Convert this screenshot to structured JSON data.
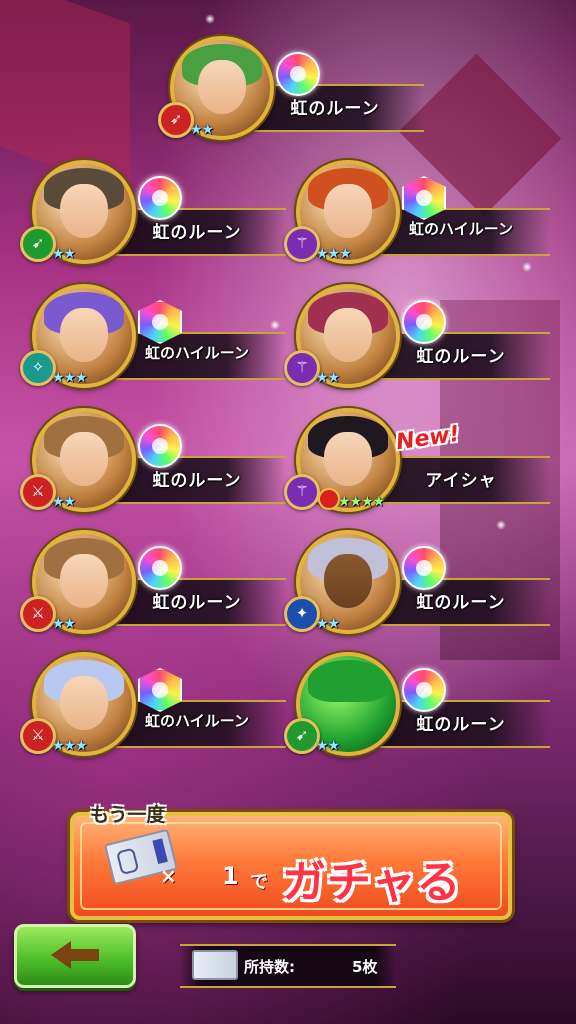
{
  "results": [
    {
      "name": "虹のルーン",
      "rune": "rune-icon",
      "weapon": "bow-icon",
      "weapon_color": "#c22",
      "stars": "★★",
      "star_color": "#8fe6ff",
      "hair": "#4aa040",
      "new": false
    },
    {
      "name": "虹のルーン",
      "rune": "rune-icon",
      "weapon": "spear-icon",
      "weapon_color": "#1f9a2e",
      "stars": "★★",
      "star_color": "#8fe6ff",
      "hair": "#5a4a3a",
      "new": false
    },
    {
      "name": "虹のハイルーン",
      "rune": "high-rune-icon",
      "weapon": "staff-icon",
      "weapon_color": "#7a2db0",
      "stars": "★★★",
      "star_color": "#8fe6ff",
      "hair": "#d05020",
      "new": false
    },
    {
      "name": "虹のハイルーン",
      "rune": "high-rune-icon",
      "weapon": "wing-icon",
      "weapon_color": "#1a9a8c",
      "stars": "★★★",
      "star_color": "#8fe6ff",
      "hair": "#7a5ad0",
      "new": false
    },
    {
      "name": "虹のルーン",
      "rune": "rune-icon",
      "weapon": "staff-icon",
      "weapon_color": "#7a2db0",
      "stars": "★★",
      "star_color": "#8fe6ff",
      "hair": "#a03050",
      "new": false
    },
    {
      "name": "虹のルーン",
      "rune": "rune-icon",
      "weapon": "sword-icon",
      "weapon_color": "#c22",
      "stars": "★★",
      "star_color": "#8fe6ff",
      "hair": "#a07040",
      "new": false
    },
    {
      "name": "アイシャ",
      "rune": "",
      "weapon": "staff-icon",
      "weapon_color": "#7a2db0",
      "stars": "★★★★",
      "star_color": "#9cff6a",
      "hair": "#201820",
      "new": true
    },
    {
      "name": "虹のルーン",
      "rune": "rune-icon",
      "weapon": "sword-icon",
      "weapon_color": "#c22",
      "stars": "★★",
      "star_color": "#8fe6ff",
      "hair": "#a07040",
      "new": false
    },
    {
      "name": "虹のルーン",
      "rune": "rune-icon",
      "weapon": "wand-icon",
      "weapon_color": "#1a4fb0",
      "stars": "★★",
      "star_color": "#8fe6ff",
      "hair": "#c0c0d8",
      "new": false
    },
    {
      "name": "虹のハイルーン",
      "rune": "high-rune-icon",
      "weapon": "sword-icon",
      "weapon_color": "#c22",
      "stars": "★★★",
      "star_color": "#8fe6ff",
      "hair": "#b8c8f0",
      "new": false
    },
    {
      "name": "虹のルーン",
      "rune": "rune-icon",
      "weapon": "spear-icon",
      "weapon_color": "#1f9a2e",
      "stars": "★★",
      "star_color": "#8fe6ff",
      "hair": "#20a030",
      "new": false
    }
  ],
  "new_label": "New!",
  "gacha": {
    "again_label": "もう一度",
    "times": "×",
    "count": "1",
    "de": "で",
    "action": "ガチャる"
  },
  "owned": {
    "label": "所持数:",
    "value": "5枚"
  }
}
